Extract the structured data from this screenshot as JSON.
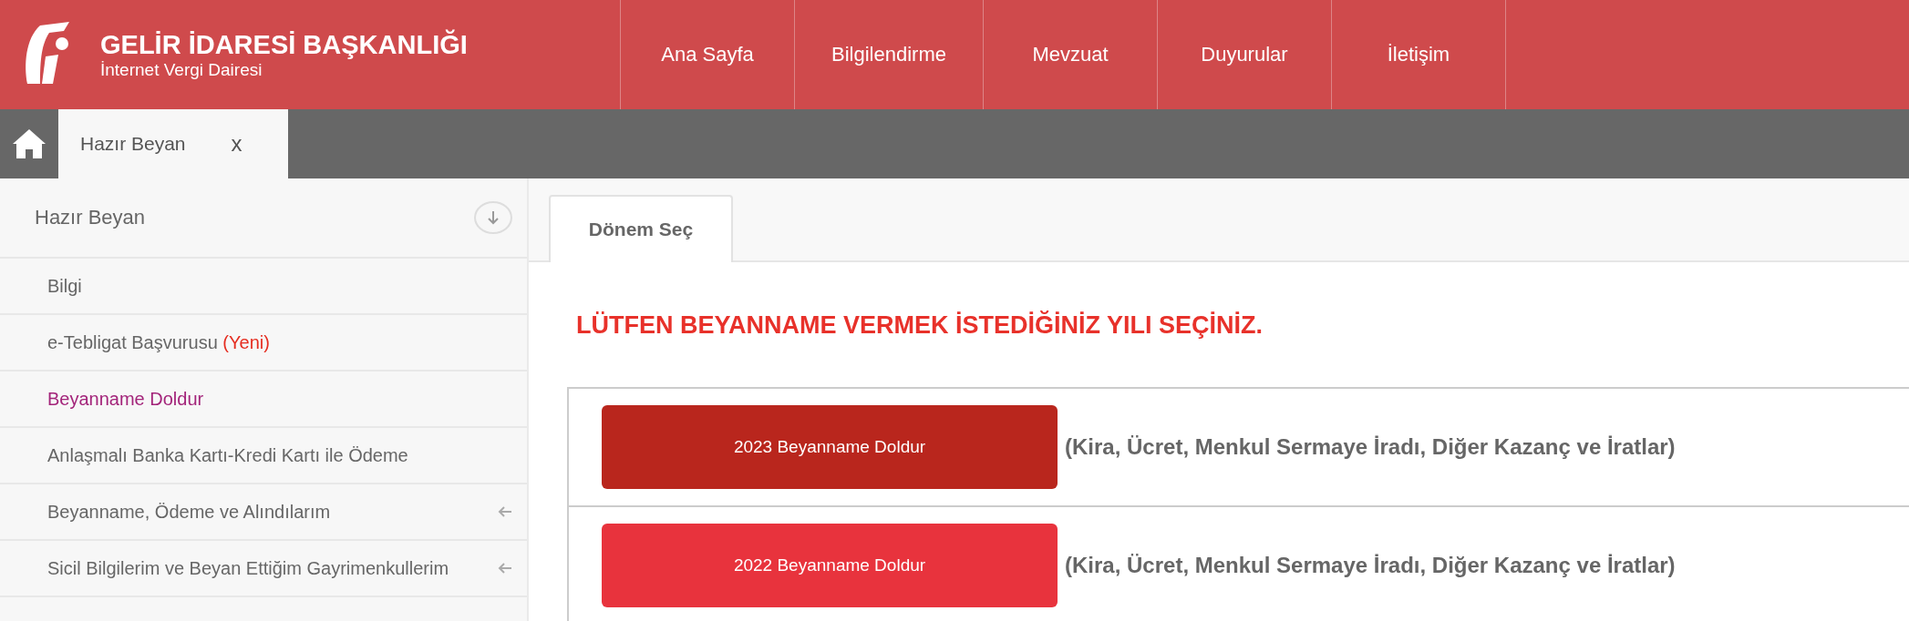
{
  "header": {
    "title": "GELİR İDARESİ BAŞKANLIĞI",
    "subtitle": "İnternet Vergi Dairesi"
  },
  "nav": [
    "Ana Sayfa",
    "Bilgilendirme",
    "Mevzuat",
    "Duyurular",
    "İletişim"
  ],
  "open_tabs": [
    {
      "label": "Hazır Beyan",
      "close": "x",
      "selected": true
    }
  ],
  "sidebar": {
    "title": "Hazır Beyan",
    "items": [
      {
        "label": "Bilgi",
        "selected": false,
        "expandable": false
      },
      {
        "label": "e-Tebligat Başvurusu",
        "badge": "(Yeni)",
        "selected": false,
        "expandable": false
      },
      {
        "label": "Beyanname Doldur",
        "selected": true,
        "expandable": false
      },
      {
        "label": "Anlaşmalı Banka Kartı-Kredi Kartı ile Ödeme",
        "selected": false,
        "expandable": false
      },
      {
        "label": "Beyanname, Ödeme ve Alındılarım",
        "selected": false,
        "expandable": true
      },
      {
        "label": "Sicil Bilgilerim ve Beyan Ettiğim Gayrimenkullerim",
        "selected": false,
        "expandable": true
      }
    ]
  },
  "content_tabs": [
    {
      "label": "Dönem Seç",
      "selected": true
    }
  ],
  "heading": "LÜTFEN BEYANNAME VERMEK İSTEDİĞİNİZ YILI SEÇİNİZ.",
  "rows": [
    {
      "button": "2023 Beyanname Doldur",
      "description": "(Kira, Ücret, Menkul Sermaye İradı, Diğer Kazanç ve İratlar)",
      "selected": true
    },
    {
      "button": "2022 Beyanname Doldur",
      "description": "(Kira, Ücret, Menkul Sermaye İradı, Diğer Kazanç ve İratlar)",
      "selected": false
    }
  ]
}
